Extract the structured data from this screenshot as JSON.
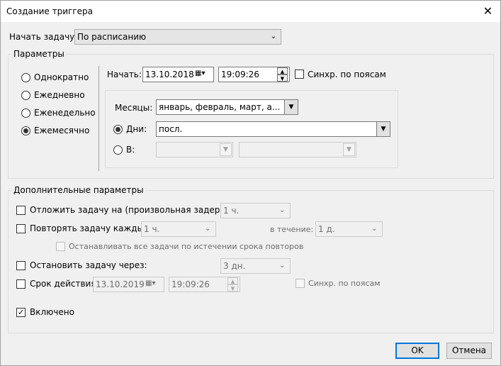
{
  "window": {
    "title": "Создание триггера",
    "close": "✕"
  },
  "start_task": {
    "label": "Начать задачу:",
    "value": "По расписанию"
  },
  "params": {
    "legend": "Параметры",
    "radios": [
      "Однократно",
      "Ежедневно",
      "Еженедельно",
      "Ежемесячно"
    ],
    "selected_index": 3,
    "start_label": "Начать:",
    "start_date": "13.10.2018",
    "start_time": "19:09:26",
    "sync_label": "Синхр. по поясам",
    "months_label": "Месяцы:",
    "months_value": "январь, февраль, март, а...",
    "days_label": "Дни:",
    "days_value": "посл.",
    "in_label": "В:"
  },
  "advanced": {
    "legend": "Дополнительные параметры",
    "delay_label": "Отложить задачу на (произвольная задержка):",
    "delay_value": "1 ч.",
    "repeat_label": "Повторять задачу каждые:",
    "repeat_value": "1 ч.",
    "during_label": "в течение:",
    "during_value": "1 д.",
    "stop_all_label": "Останавливать все задачи по истечении срока повторов",
    "stop_after_label": "Остановить задачу через:",
    "stop_after_value": "3 дн.",
    "expire_label": "Срок действия:",
    "expire_date": "13.10.2019",
    "expire_time": "19:09:26",
    "expire_sync_label": "Синхр. по поясам",
    "enabled_label": "Включено",
    "check_mark": "✓"
  },
  "buttons": {
    "ok": "OK",
    "cancel": "Отмена"
  },
  "icons": {
    "dropdown": "chevron-down-icon",
    "calendar": "calendar-icon",
    "spin_up": "▲",
    "spin_down": "▼"
  }
}
